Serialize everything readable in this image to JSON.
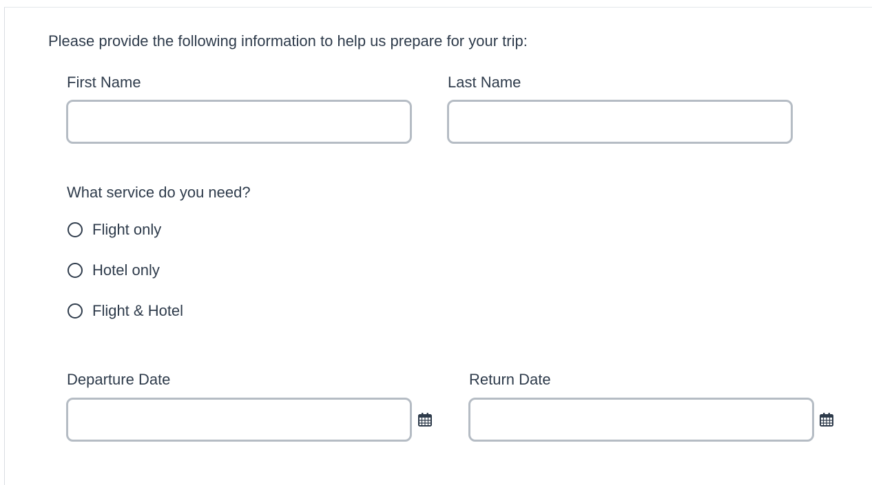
{
  "form": {
    "intro_text": "Please provide the following information to help us prepare for your trip:",
    "first_name": {
      "label": "First Name",
      "value": "",
      "placeholder": ""
    },
    "last_name": {
      "label": "Last Name",
      "value": "",
      "placeholder": ""
    },
    "service": {
      "question": "What service do you need?",
      "options": [
        {
          "label": "Flight only",
          "selected": false
        },
        {
          "label": "Hotel only",
          "selected": false
        },
        {
          "label": "Flight & Hotel",
          "selected": false
        }
      ]
    },
    "departure_date": {
      "label": "Departure Date",
      "value": "",
      "placeholder": "",
      "icon": "calendar-icon"
    },
    "return_date": {
      "label": "Return Date",
      "value": "",
      "placeholder": "",
      "icon": "calendar-icon"
    }
  },
  "colors": {
    "text": "#2e3b4b",
    "input_border": "#b5bcc4",
    "frame_border": "#d9dde2"
  }
}
